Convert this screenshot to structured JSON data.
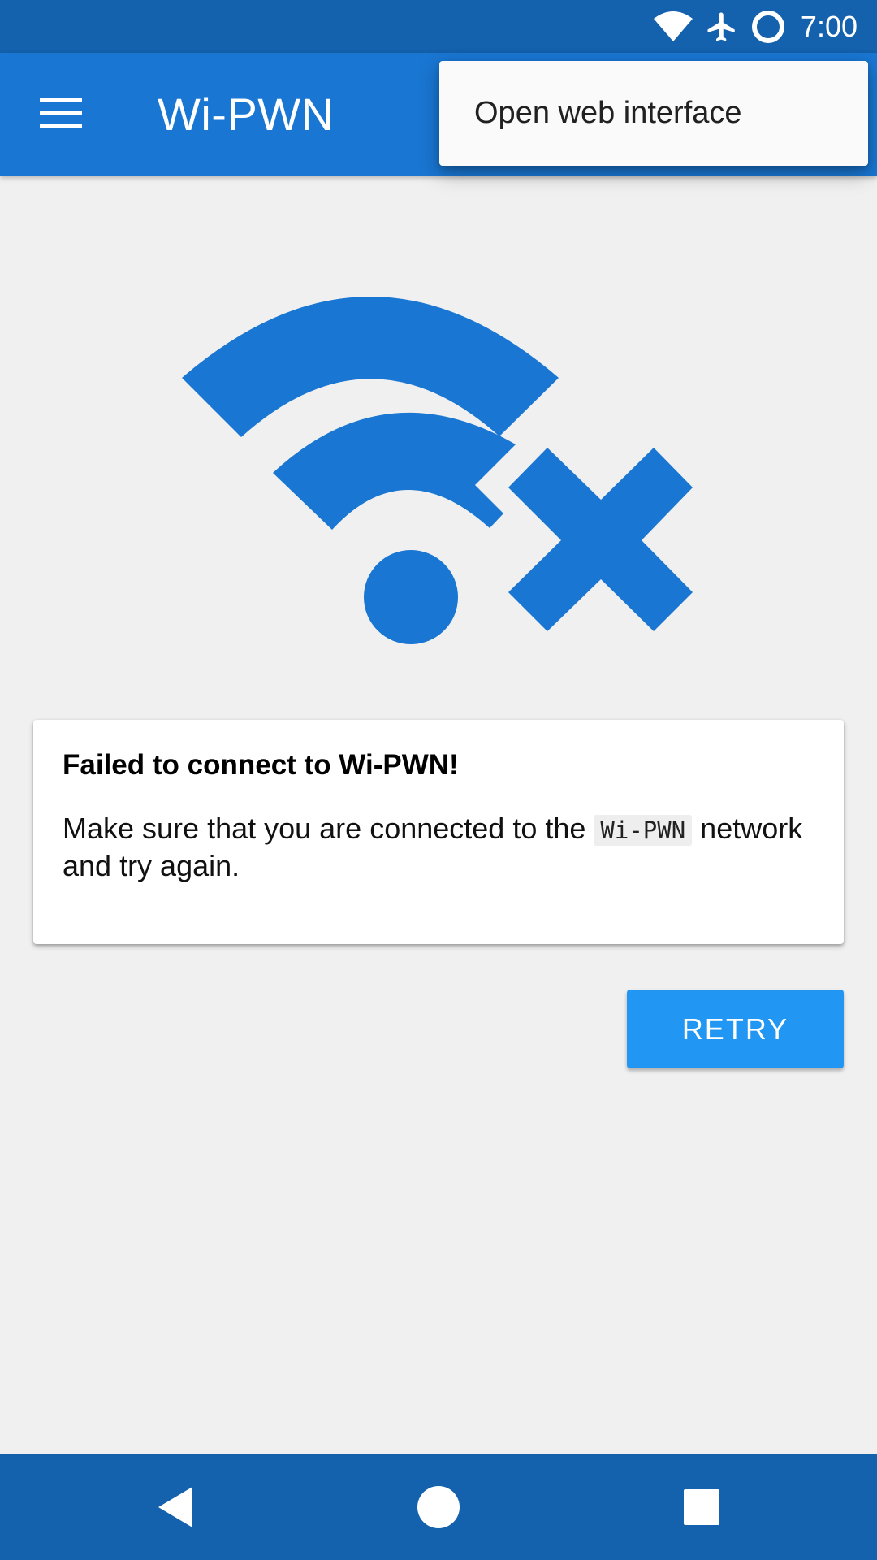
{
  "status_bar": {
    "time": "7:00",
    "icons": [
      "wifi-icon",
      "airplane-mode-icon",
      "sync-circle-icon"
    ]
  },
  "app_bar": {
    "title": "Wi-PWN",
    "menu_icon": "hamburger-menu-icon"
  },
  "popup_menu": {
    "items": [
      {
        "label": "Open web interface"
      }
    ]
  },
  "hero": {
    "icon": "wifi-off-icon",
    "color": "#1976d2"
  },
  "error_card": {
    "title": "Failed to connect to Wi-PWN!",
    "message_before": "Make sure that you are connected to the ",
    "network_name": "Wi-PWN",
    "message_after": " network and try again."
  },
  "retry_button": {
    "label": "RETRY"
  },
  "nav_bar": {
    "buttons": [
      "back-icon",
      "home-icon",
      "recents-icon"
    ]
  },
  "colors": {
    "status_bar": "#1461ad",
    "app_bar": "#1976d2",
    "accent": "#2196f3",
    "background": "#f0f0f0"
  }
}
